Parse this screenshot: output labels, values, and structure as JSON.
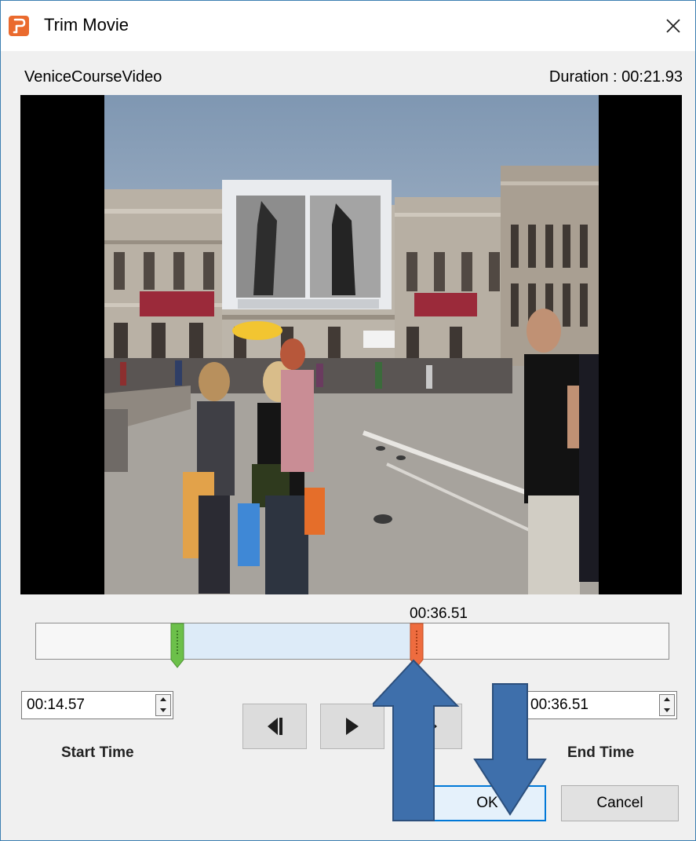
{
  "window": {
    "title": "Trim Movie"
  },
  "video": {
    "name": "VeniceCourseVideo",
    "duration": "Duration : 00:21.93"
  },
  "timeline": {
    "playhead_label": "00:36.51",
    "selection_start_fraction": 0.221,
    "selection_end_fraction": 0.596
  },
  "start_time": {
    "value": "00:14.57",
    "label": "Start Time"
  },
  "end_time": {
    "value": "00:36.51",
    "label": "End Time"
  },
  "buttons": {
    "ok": "OK",
    "cancel": "Cancel"
  },
  "colors": {
    "accent": "#0078d7",
    "start_marker": "#6cc04a",
    "end_marker": "#ee6c3f",
    "selection": "#ddebf8",
    "annotation_arrow": "#3e6fab"
  },
  "icons": {
    "app": "app-logo-icon",
    "close": "close-icon",
    "previous_frame": "previous-frame-icon",
    "play": "play-icon",
    "next_frame": "next-frame-icon"
  }
}
